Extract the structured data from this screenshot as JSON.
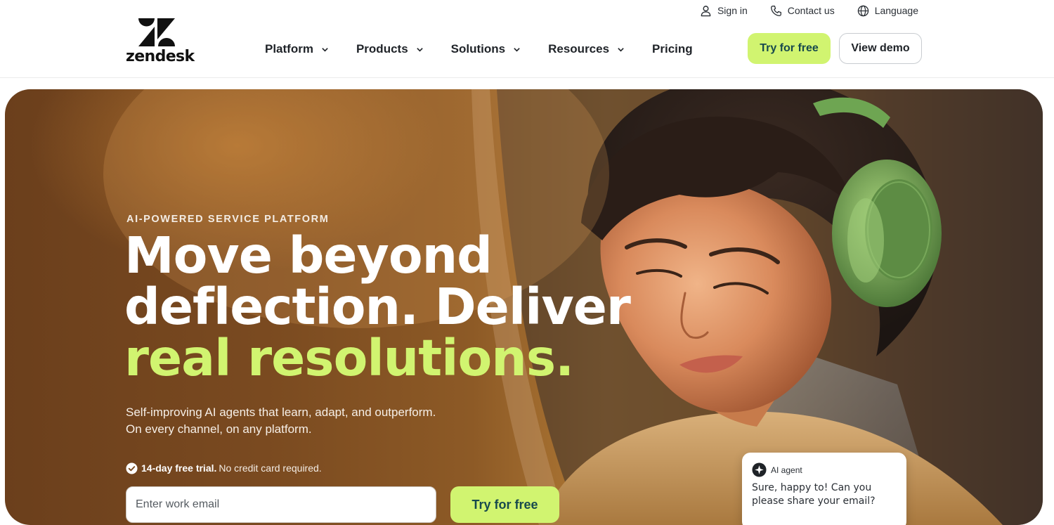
{
  "brand": {
    "name": "zendesk"
  },
  "utility_nav": {
    "sign_in": "Sign in",
    "contact": "Contact us",
    "language": "Language"
  },
  "main_nav": {
    "platform": "Platform",
    "products": "Products",
    "solutions": "Solutions",
    "resources": "Resources",
    "pricing": "Pricing"
  },
  "header_ctas": {
    "try_free": "Try for free",
    "view_demo": "View demo"
  },
  "hero": {
    "eyebrow": "AI-POWERED SERVICE PLATFORM",
    "headline_line1": "Move beyond",
    "headline_line2": "deflection. Deliver",
    "headline_line3": "real resolutions.",
    "sub_line1": "Self-improving AI agents that learn, adapt, and outperform.",
    "sub_line2": "On every channel, on any platform.",
    "trial_bold": "14-day free trial.",
    "trial_rest": "No credit card required.",
    "email_placeholder": "Enter work email",
    "cta": "Try for free"
  },
  "chat_widget": {
    "agent_label": "AI agent",
    "message": "Sure, happy to! Can you please share your email?"
  },
  "colors": {
    "accent_lime": "#d1f470",
    "cta_text": "#17494d",
    "hero_brown": "#8d5a26",
    "text_dark": "#1f2328"
  },
  "icons": [
    "person-icon",
    "phone-icon",
    "globe-icon",
    "chevron-down-icon",
    "check-circle-icon",
    "ai-agent-icon"
  ]
}
